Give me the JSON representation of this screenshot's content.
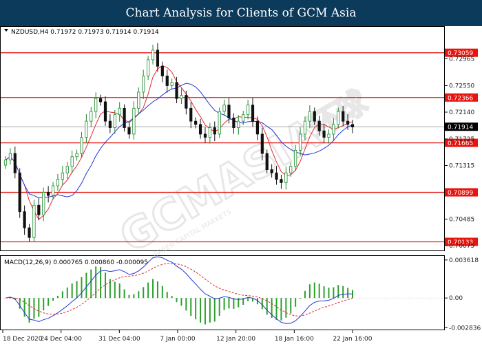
{
  "header": {
    "title": "Chart Analysis for Clients of GCM Asia"
  },
  "watermark": {
    "brand": "GCMASIA",
    "cn": "环球",
    "sub": "GREEN CAPITAL MARKETS"
  },
  "colors": {
    "header_bg": "#0b3a5b",
    "bull": "#1a8a2a",
    "bear": "#111111",
    "ma_red": "#e0292f",
    "ma_blue": "#2436d6",
    "level": "#e8140e",
    "macd_hist": "#2ca02c",
    "macd_signal": "#e0292f",
    "macd_line": "#2436d6"
  },
  "chart_data": [
    {
      "type": "candlestick",
      "symbol": "NZDUSD",
      "timeframe": "H4",
      "ohlc_label": "NZDUSD,H4  0.71972 0.71973 0.71914 0.71914",
      "ylim": [
        0.7,
        0.7346
      ],
      "y_ticks": [
        0.72965,
        0.7255,
        0.7214,
        0.71725,
        0.71315,
        0.70485,
        0.70075
      ],
      "y_tick_labels": [
        "0.72965",
        "0.72550",
        "0.72140",
        "0.71725",
        "0.71315",
        "0.70485",
        "0.70075"
      ],
      "current_price": 0.71914,
      "current_price_label": "0.71914",
      "levels": [
        0.73059,
        0.72366,
        0.71665,
        0.70899,
        0.70133
      ],
      "level_labels": [
        "0.73059",
        "0.72366",
        "0.71665",
        "0.70899",
        "0.70133"
      ],
      "x_labels": [
        "18 Dec 2020",
        "24 Dec 04:00",
        "31 Dec 04:00",
        "7 Jan 00:00",
        "12 Jan 20:00",
        "18 Jan 16:00",
        "22 Jan 16:00"
      ],
      "closes": [
        0.714,
        0.715,
        0.712,
        0.706,
        0.7035,
        0.702,
        0.707,
        0.7055,
        0.709,
        0.7085,
        0.71,
        0.711,
        0.712,
        0.713,
        0.7145,
        0.715,
        0.7175,
        0.72,
        0.7215,
        0.7235,
        0.723,
        0.72,
        0.719,
        0.721,
        0.722,
        0.719,
        0.718,
        0.722,
        0.7245,
        0.727,
        0.7295,
        0.731,
        0.7285,
        0.727,
        0.7255,
        0.726,
        0.7235,
        0.724,
        0.722,
        0.72,
        0.7195,
        0.718,
        0.7175,
        0.719,
        0.718,
        0.7215,
        0.7225,
        0.7205,
        0.719,
        0.72,
        0.721,
        0.7225,
        0.72,
        0.718,
        0.715,
        0.7125,
        0.712,
        0.711,
        0.7105,
        0.712,
        0.713,
        0.7155,
        0.718,
        0.72,
        0.7215,
        0.72,
        0.7185,
        0.7175,
        0.718,
        0.7195,
        0.7215,
        0.72,
        0.7195,
        0.7191
      ]
    },
    {
      "type": "macd",
      "label": "MACD(12,26,9) 0.000765 0.000860 -0.000095",
      "params": [
        12,
        26,
        9
      ],
      "values_text": [
        "0.000765",
        "0.000860",
        "-0.000095"
      ],
      "ylim": [
        -0.003,
        0.004
      ],
      "y_ticks": [
        0.003618,
        0.0,
        -0.002836
      ],
      "y_tick_labels": [
        "0.003618",
        "0.00",
        "-0.002836"
      ]
    }
  ]
}
